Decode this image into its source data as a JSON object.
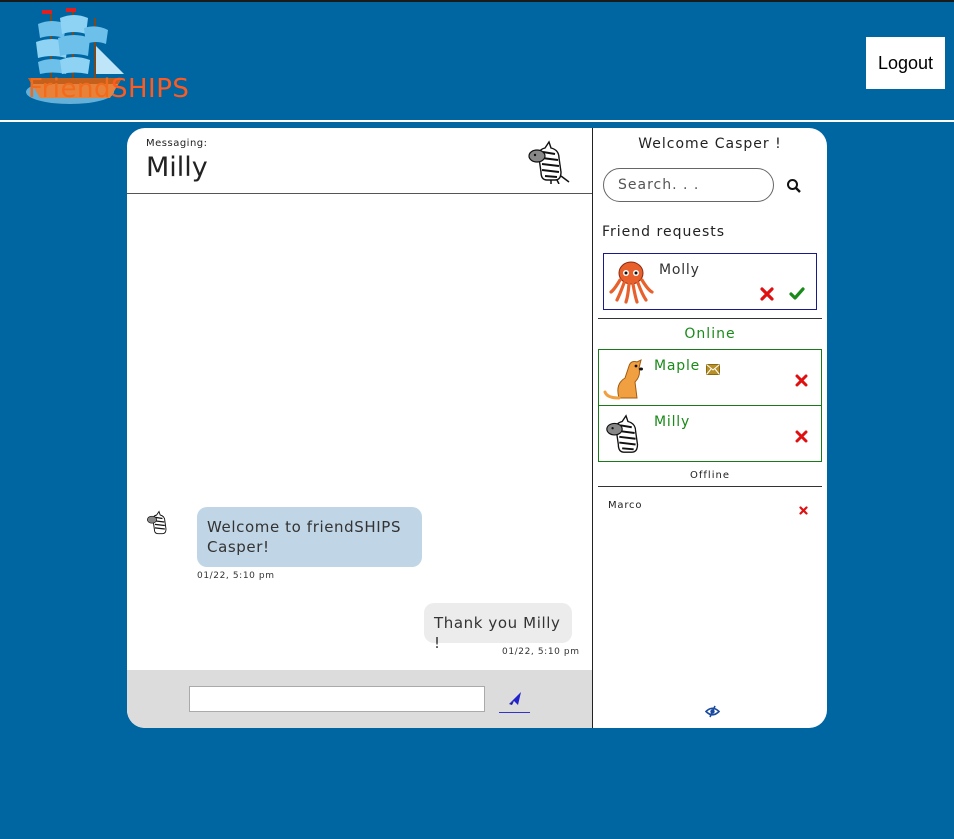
{
  "header": {
    "logo_text_part1": "Friend",
    "logo_text_part2": "SHIPS",
    "logout_label": "Logout"
  },
  "chat": {
    "messaging_label": "Messaging:",
    "contact_name": "Milly",
    "contact_avatar_icon": "zebra-icon",
    "messages": [
      {
        "direction": "incoming",
        "text": "Welcome to friendSHIPS Casper!",
        "timestamp": "01/22, 5:10 pm"
      },
      {
        "direction": "outgoing",
        "text": "Thank you Milly !",
        "timestamp": "01/22, 5:10 pm"
      }
    ],
    "input_value": "",
    "send_icon": "paper-plane-icon"
  },
  "sidebar": {
    "welcome": "Welcome Casper !",
    "search_placeholder": "Search. . .",
    "friend_requests_title": "Friend requests",
    "friend_requests": [
      {
        "name": "Molly",
        "avatar_icon": "octopus-icon"
      }
    ],
    "online_title": "Online",
    "online": [
      {
        "name": "Maple",
        "avatar_icon": "dog-icon",
        "unread_icon": "mail-icon"
      },
      {
        "name": "Milly",
        "avatar_icon": "zebra-icon"
      }
    ],
    "offline_title": "Offline",
    "offline": [
      {
        "name": "Marco"
      }
    ]
  },
  "colors": {
    "background": "#0066a1",
    "online_green": "#1a8a1a",
    "decline_red": "#e01010",
    "accept_green": "#1a8a1a",
    "incoming_bubble": "#c0d5e5",
    "outgoing_bubble": "#ececec"
  }
}
